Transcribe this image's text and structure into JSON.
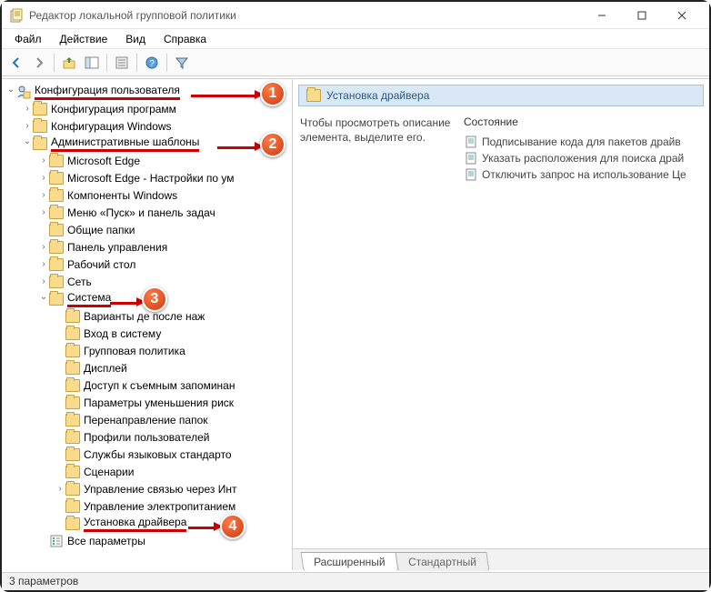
{
  "window": {
    "title": "Редактор локальной групповой политики"
  },
  "menu": {
    "file": "Файл",
    "action": "Действие",
    "view": "Вид",
    "help": "Справка"
  },
  "tree": {
    "root": "Конфигурация пользователя",
    "cfg_programs": "Конфигурация программ",
    "cfg_windows": "Конфигурация Windows",
    "admin_templates": "Административные шаблоны",
    "edge": "Microsoft Edge",
    "edge_default": "Microsoft Edge - Настройки по ум",
    "components": "Компоненты Windows",
    "startmenu": "Меню «Пуск» и панель задач",
    "shared_folders": "Общие папки",
    "control_panel": "Панель управления",
    "desktop": "Рабочий стол",
    "network": "Сеть",
    "system": "Система",
    "variants": "Варианты де            после наж",
    "logon": "Вход в систему",
    "group_policy": "Групповая политика",
    "display": "Дисплей",
    "removable": "Доступ к съемным запоминан",
    "risk_params": "Параметры уменьшения риск",
    "folder_redirect": "Перенаправление папок",
    "user_profiles": "Профили пользователей",
    "lang_services": "Службы языковых стандарто",
    "scripts": "Сценарии",
    "internet_comm": "Управление связью через Инт",
    "power": "Управление электропитанием",
    "driver_install": "Установка драйвера",
    "all_settings": "Все параметры"
  },
  "right": {
    "header": "Установка драйвера",
    "hint": "Чтобы просмотреть описание элемента, выделите его.",
    "col_state": "Состояние",
    "settings": [
      "Подписывание кода для пакетов драйв",
      "Указать расположения для поиска драй",
      "Отключить запрос на использование Це"
    ],
    "tab_extended": "Расширенный",
    "tab_standard": "Стандартный"
  },
  "status": {
    "text": "3 параметров"
  }
}
